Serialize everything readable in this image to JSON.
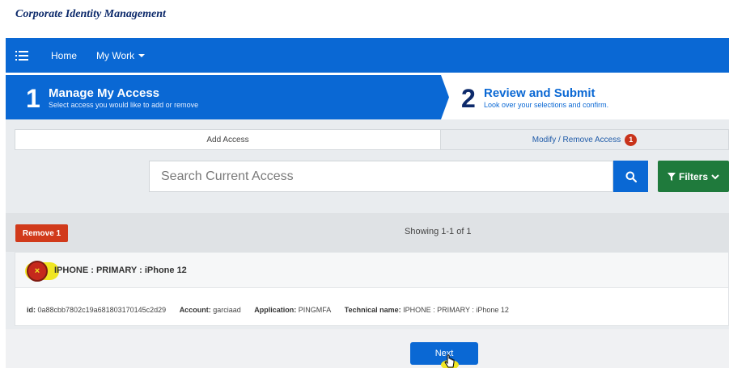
{
  "app": {
    "brand": "Corporate Identity Management"
  },
  "nav": {
    "home": "Home",
    "my_work": "My Work"
  },
  "wizard": {
    "step1": {
      "number": "1",
      "title": "Manage My Access",
      "subtitle": "Select access you would like to add or remove"
    },
    "step2": {
      "number": "2",
      "title": "Review and Submit",
      "subtitle": "Look over your selections and confirm."
    }
  },
  "tabs": {
    "add": "Add Access",
    "modify": "Modify / Remove Access",
    "modify_badge": "1"
  },
  "search": {
    "placeholder": "Search Current Access",
    "filters_label": "Filters"
  },
  "results": {
    "remove_label": "Remove 1",
    "showing": "Showing 1-1 of 1"
  },
  "item": {
    "title": "IPHONE : PRIMARY : iPhone 12",
    "remove_glyph": "×",
    "id_label": "id:",
    "id_value": "0a88cbb7802c19a681803170145c2d29",
    "account_label": "Account:",
    "account_value": "garciaad",
    "application_label": "Application:",
    "application_value": "PINGMFA",
    "technical_label": "Technical name:",
    "technical_value": "IPHONE : PRIMARY : iPhone 12"
  },
  "footer": {
    "next_label": "Next"
  },
  "colors": {
    "primary": "#0a68d4",
    "danger": "#d13a1b",
    "success": "#1f7a3c",
    "highlight": "#f0e623"
  },
  "icons": [
    "list-icon",
    "chevron-down-icon",
    "search-icon",
    "filter-icon",
    "close-icon",
    "hand-cursor-icon"
  ]
}
